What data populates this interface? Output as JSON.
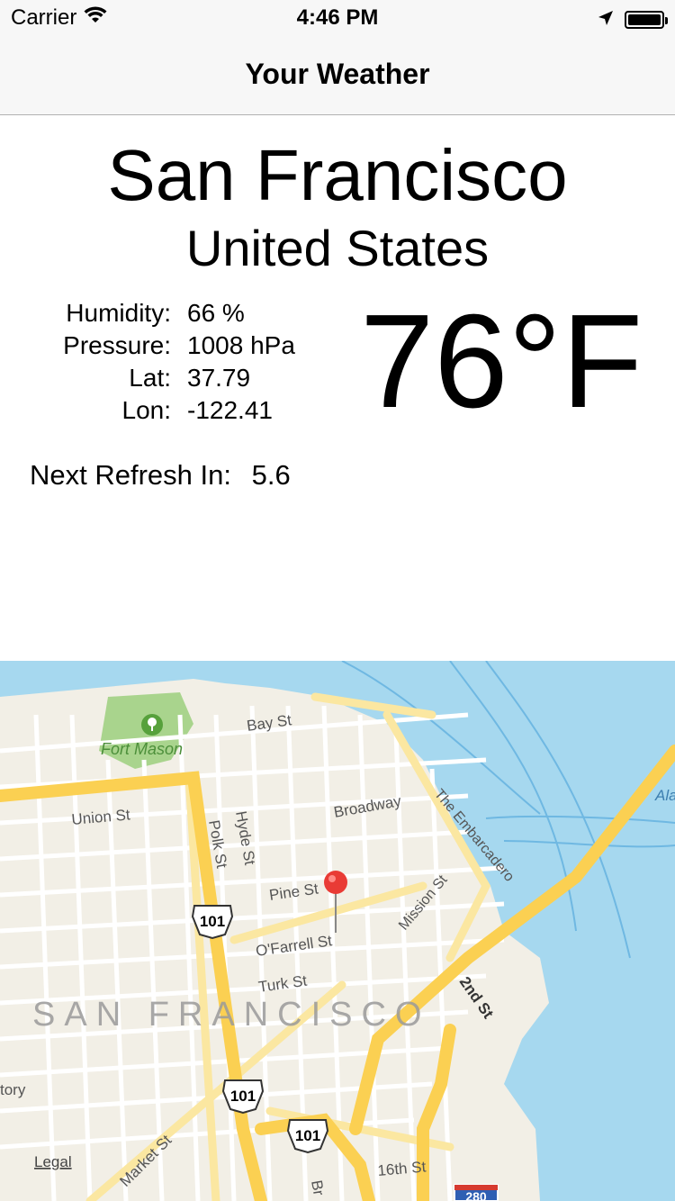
{
  "status_bar": {
    "carrier": "Carrier",
    "time": "4:46 PM",
    "battery_level": 1.0
  },
  "nav": {
    "title": "Your Weather"
  },
  "weather": {
    "city": "San Francisco",
    "country": "United States",
    "details": [
      {
        "label": "Humidity:",
        "value": "66 %"
      },
      {
        "label": "Pressure:",
        "value": "1008 hPa"
      },
      {
        "label": "Lat:",
        "value": "37.79"
      },
      {
        "label": "Lon:",
        "value": "-122.41"
      }
    ],
    "temperature": "76°F",
    "refresh_label": "Next Refresh In:",
    "refresh_value": "5.6"
  },
  "map": {
    "labels": {
      "fort_mason": "Fort Mason",
      "bay_st": "Bay St",
      "union_st": "Union St",
      "polk_st": "Polk St",
      "hyde_st": "Hyde St",
      "broadway": "Broadway",
      "embarcadero": "The Embarcadero",
      "mission_st": "Mission St",
      "pine_st": "Pine St",
      "ofarrell_st": "O'Farrell St",
      "turk_st": "Turk St",
      "second_st": "2nd St",
      "city_name": "SAN FRANCISCO",
      "market_st": "Market St",
      "sixteenth_st": "16th St",
      "ala": "Ala",
      "tory": "tory",
      "br": "Br",
      "legal": "Legal",
      "hwy_101": "101",
      "i_280": "280"
    },
    "colors": {
      "water": "#a6d8ef",
      "land": "#f2efe6",
      "park": "#a9d48d",
      "highway": "#fbd052",
      "major_road": "#fbe7a1",
      "pin": "#e93b35"
    }
  }
}
